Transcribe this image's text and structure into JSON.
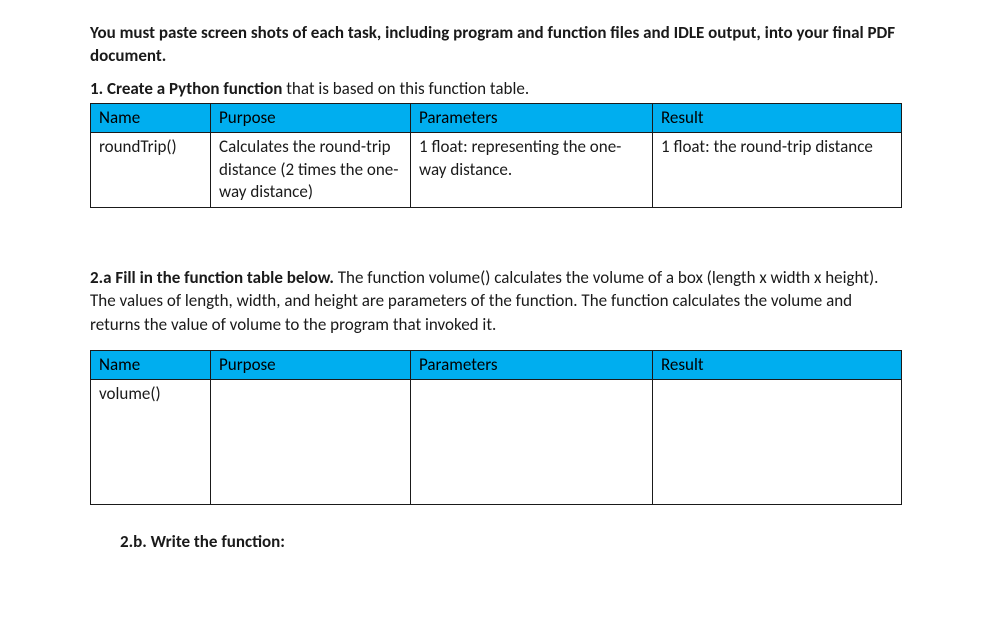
{
  "instructions": "You must paste screen shots of each task, including program and function files and IDLE output, into your final PDF document.",
  "task1": {
    "lead": "1. Create a Python function",
    "rest": " that is based on this function table.",
    "headers": {
      "name": "Name",
      "purpose": "Purpose",
      "parameters": "Parameters",
      "result": "Result"
    },
    "row": {
      "name": "roundTrip()",
      "purpose": "Calculates the round-trip distance (2 times the one-way distance)",
      "parameters": "1 float: representing the one-way distance.",
      "result": "1 float: the round-trip distance"
    }
  },
  "task2a": {
    "lead": "2.a Fill in the function table below.",
    "rest": "   The function volume() calculates the volume of a box (length x width x height). The values of length, width, and height are parameters of the function.   The function calculates the volume and returns the value of volume to the program that invoked it.",
    "headers": {
      "name": "Name",
      "purpose": "Purpose",
      "parameters": "Parameters",
      "result": "Result"
    },
    "row": {
      "name": "volume()",
      "purpose": "",
      "parameters": "",
      "result": ""
    }
  },
  "task2b": {
    "label": "2.b.  Write the function:"
  }
}
